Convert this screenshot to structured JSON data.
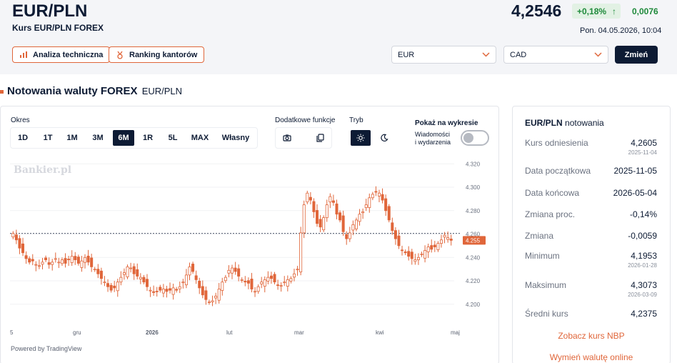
{
  "header": {
    "title": "EUR/PLN",
    "subtitle": "Kurs EUR/PLN FOREX",
    "rate": "4,2546",
    "change_pct": "+0,18%",
    "change_arrow": "↑",
    "change_abs": "0,0076",
    "datetime": "Pon. 04.05.2026, 10:04"
  },
  "actions": {
    "technical": "Analiza techniczna",
    "ranking": "Ranking kantorów"
  },
  "converter": {
    "from": "EUR",
    "to": "CAD",
    "button": "Zmień"
  },
  "section": {
    "title": "Notowania waluty FOREX",
    "pair": "EUR/PLN"
  },
  "controls": {
    "period_label": "Okres",
    "periods": [
      "1D",
      "1T",
      "1M",
      "3M",
      "6M",
      "1R",
      "5L",
      "MAX",
      "Własny"
    ],
    "active_period": "6M",
    "functions_label": "Dodatkowe funkcje",
    "mode_label": "Tryb",
    "show_label": "Pokaż na wykresie",
    "toggle_text_1": "Wiadomości",
    "toggle_text_2": "i wydarzenia",
    "toggle_on": false
  },
  "chart_data": {
    "type": "candlestick",
    "watermark": "Bankier.pl",
    "powered_by": "Powered by TradingView",
    "y_ticks": [
      "4.320",
      "4.300",
      "4.280",
      "4.260",
      "4.240",
      "4.220",
      "4.200"
    ],
    "ylim": [
      4.195,
      4.322
    ],
    "x_ticks": [
      "5",
      "gru",
      "2026",
      "lut",
      "mar",
      "kwi",
      "maj"
    ],
    "last_price_label": "4.255",
    "last_price": 4.2546,
    "reference_level": 4.2605,
    "up_color": "#ffffff",
    "down_color": "#e0663a",
    "closes": [
      4.2605,
      4.255,
      4.248,
      4.244,
      4.239,
      4.236,
      4.237,
      4.234,
      4.233,
      4.236,
      4.238,
      4.234,
      4.236,
      4.239,
      4.236,
      4.238,
      4.235,
      4.238,
      4.241,
      4.238,
      4.235,
      4.237,
      4.24,
      4.236,
      4.232,
      4.23,
      4.226,
      4.222,
      4.219,
      4.215,
      4.212,
      4.214,
      4.219,
      4.223,
      4.227,
      4.232,
      4.231,
      4.226,
      4.224,
      4.223,
      4.219,
      4.215,
      4.212,
      4.21,
      4.211,
      4.212,
      4.213,
      4.211,
      4.212,
      4.214,
      4.212,
      4.215,
      4.219,
      4.225,
      4.232,
      4.228,
      4.221,
      4.214,
      4.208,
      4.204,
      4.202,
      4.203,
      4.207,
      4.213,
      4.219,
      4.223,
      4.229,
      4.231,
      4.228,
      4.224,
      4.221,
      4.219,
      4.218,
      4.213,
      4.211,
      4.215,
      4.219,
      4.221,
      4.223,
      4.222,
      4.219,
      4.216,
      4.216,
      4.219,
      4.221,
      4.222,
      4.226,
      4.23,
      4.261,
      4.285,
      4.295,
      4.289,
      4.279,
      4.269,
      4.266,
      4.274,
      4.285,
      4.292,
      4.287,
      4.277,
      4.272,
      4.262,
      4.256,
      4.261,
      4.268,
      4.272,
      4.277,
      4.279,
      4.285,
      4.291,
      4.294,
      4.296,
      4.295,
      4.289,
      4.28,
      4.272,
      4.263,
      4.256,
      4.25,
      4.246,
      4.244,
      4.241,
      4.239,
      4.238,
      4.24,
      4.243,
      4.246,
      4.249,
      4.247,
      4.249,
      4.252,
      4.255,
      4.259,
      4.257,
      4.2546
    ]
  },
  "stats": {
    "head_pair": "EUR/PLN",
    "head_rest": "notowania",
    "rows": [
      {
        "label": "Kurs odniesienia",
        "value": "4,2605",
        "sub": "2025-11-04"
      },
      {
        "label": "Data początkowa",
        "value": "2025-11-05",
        "sub": ""
      },
      {
        "label": "Data końcowa",
        "value": "2026-05-04",
        "sub": ""
      },
      {
        "label": "Zmiana proc.",
        "value": "-0,14%",
        "sub": ""
      },
      {
        "label": "Zmiana",
        "value": "-0,0059",
        "sub": ""
      },
      {
        "label": "Minimum",
        "value": "4,1953",
        "sub": "2026-01-28"
      },
      {
        "label": "Maksimum",
        "value": "4,3073",
        "sub": "2026-03-09"
      },
      {
        "label": "Średni kurs",
        "value": "4,2375",
        "sub": ""
      }
    ],
    "link_nbp": "Zobacz kurs NBP",
    "link_exchange": "Wymień walutę online"
  }
}
